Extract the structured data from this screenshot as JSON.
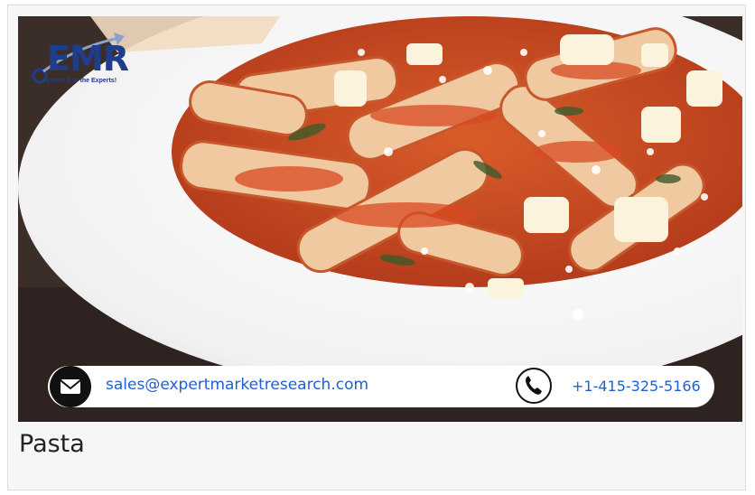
{
  "image": {
    "alt": "Pasta"
  },
  "logo": {
    "name": "EMR",
    "tagline": "Leave it to the Experts!"
  },
  "contact": {
    "email": "sales@expertmarketresearch.com",
    "phone": "+1-415-325-5166",
    "email_icon": "envelope-icon",
    "phone_icon": "phone-icon"
  },
  "caption": {
    "title": "Pasta"
  },
  "colors": {
    "brand": "#1f3d8c",
    "link": "#1f5fd6",
    "icon_bg": "#111111"
  }
}
